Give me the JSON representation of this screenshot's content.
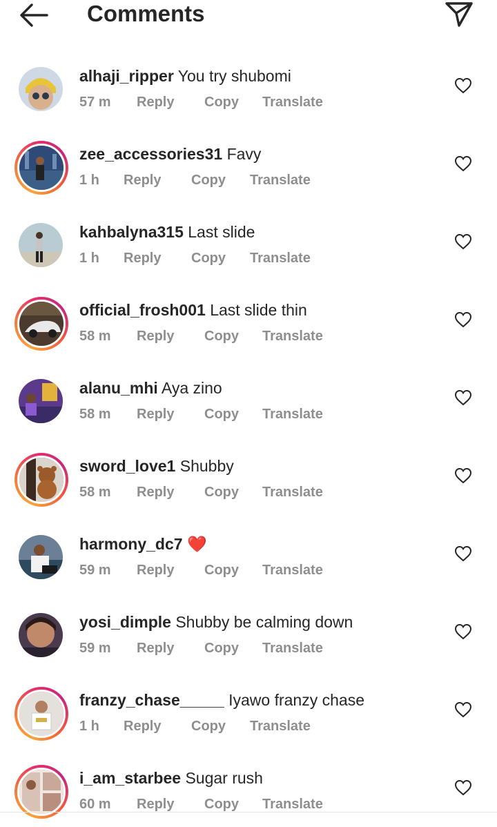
{
  "header": {
    "title": "Comments",
    "back_icon": "arrow-left-icon",
    "share_icon": "paper-plane-icon"
  },
  "colors": {
    "text": "#262626",
    "meta": "#8e8e8e",
    "ring_gradient": [
      "#f9a43a",
      "#e6306a",
      "#c7267d"
    ],
    "heart_emoji": "#e0162b"
  },
  "comments": [
    {
      "username": "alhaji_ripper",
      "text": "You try shubomi",
      "time": "57 m",
      "reply": "Reply",
      "copy": "Copy",
      "translate": "Translate",
      "story_ring": false
    },
    {
      "username": "zee_accessories31",
      "text": "Favy",
      "time": "1 h",
      "reply": "Reply",
      "copy": "Copy",
      "translate": "Translate",
      "story_ring": true
    },
    {
      "username": "kahbalyna315",
      "text": "Last slide",
      "time": "1 h",
      "reply": "Reply",
      "copy": "Copy",
      "translate": "Translate",
      "story_ring": false
    },
    {
      "username": "official_frosh001",
      "text": "Last slide thin",
      "time": "58 m",
      "reply": "Reply",
      "copy": "Copy",
      "translate": "Translate",
      "story_ring": true
    },
    {
      "username": "alanu_mhi",
      "text": "Aya zino",
      "time": "58 m",
      "reply": "Reply",
      "copy": "Copy",
      "translate": "Translate",
      "story_ring": false
    },
    {
      "username": "sword_love1",
      "text": "Shubby",
      "time": "58 m",
      "reply": "Reply",
      "copy": "Copy",
      "translate": "Translate",
      "story_ring": true
    },
    {
      "username": "harmony_dc7",
      "text": "❤️",
      "time": "59 m",
      "reply": "Reply",
      "copy": "Copy",
      "translate": "Translate",
      "story_ring": false
    },
    {
      "username": "yosi_dimple",
      "text": "Shubby be calming down",
      "time": "59 m",
      "reply": "Reply",
      "copy": "Copy",
      "translate": "Translate",
      "story_ring": false
    },
    {
      "username": "franzy_chase_____",
      "text": "Iyawo franzy chase",
      "time": "1 h",
      "reply": "Reply",
      "copy": "Copy",
      "translate": "Translate",
      "story_ring": true
    },
    {
      "username": "i_am_starbee",
      "text": "Sugar rush",
      "time": "60 m",
      "reply": "Reply",
      "copy": "Copy",
      "translate": "Translate",
      "story_ring": true
    }
  ]
}
